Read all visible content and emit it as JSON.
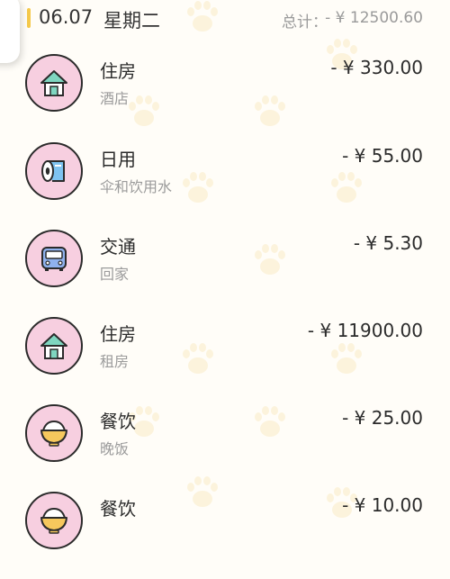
{
  "day": {
    "date": "06.07",
    "weekday": "星期二",
    "total_label": "总计：",
    "total_value": "- ¥ 12500.60"
  },
  "records": [
    {
      "category": "住房",
      "remark": "酒店",
      "amount": "- ¥ 330.00",
      "icon": "house-icon"
    },
    {
      "category": "日用",
      "remark": "伞和饮用水",
      "amount": "- ¥ 55.00",
      "icon": "toilet-paper-icon"
    },
    {
      "category": "交通",
      "remark": "回家",
      "amount": "- ¥ 5.30",
      "icon": "bus-icon"
    },
    {
      "category": "住房",
      "remark": "租房",
      "amount": "- ¥ 11900.00",
      "icon": "house-icon"
    },
    {
      "category": "餐饮",
      "remark": "晚饭",
      "amount": "- ¥ 25.00",
      "icon": "rice-bowl-icon"
    },
    {
      "category": "餐饮",
      "remark": "",
      "amount": "- ¥ 10.00",
      "icon": "rice-bowl-icon"
    }
  ],
  "colors": {
    "icon_background": "#f7cfe0",
    "accent_yellow": "#f5c94a",
    "house_roof": "#7fd6c0",
    "tissue_blue": "#7ec3f1",
    "bus_blue": "#8fb2ee",
    "rice_bowl_yellow": "#f6c85d"
  }
}
